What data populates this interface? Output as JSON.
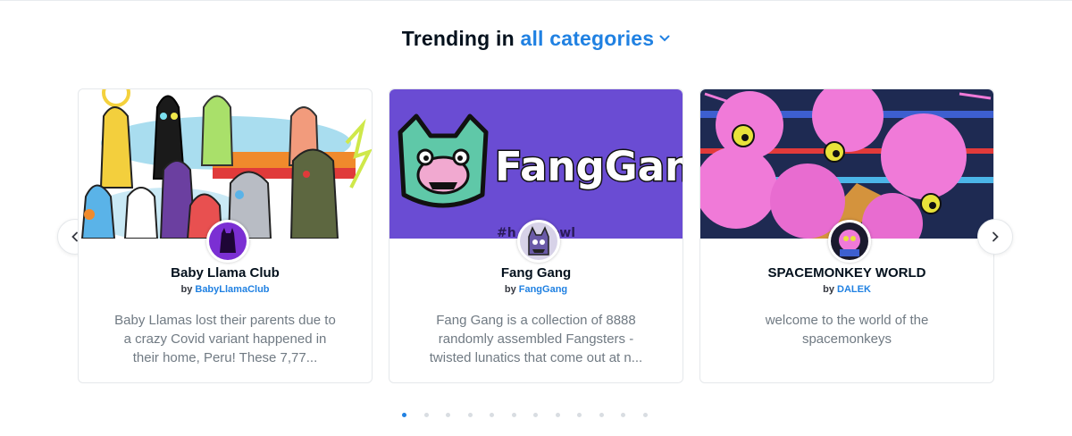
{
  "heading": {
    "prefix": "Trending in",
    "category": "all categories"
  },
  "cards": [
    {
      "title": "Baby Llama Club",
      "by_prefix": "by",
      "creator": "BabyLlamaClub",
      "description": "Baby Llamas lost their parents due to a crazy Covid variant happened in their home, Peru! These 7,77..."
    },
    {
      "title": "Fang Gang",
      "by_prefix": "by",
      "creator": "FangGang",
      "description": "Fang Gang is a collection of 8888 randomly assembled Fangsters - twisted lunatics that come out at n...",
      "banner_text": "FangGang",
      "banner_hashtag": "#h        owl"
    },
    {
      "title": "SPACEMONKEY WORLD",
      "by_prefix": "by",
      "creator": "DALEK",
      "description": "welcome to the world of the spacemonkeys"
    }
  ],
  "pagination": {
    "total": 12,
    "active_index": 0
  },
  "colors": {
    "accent": "#2081e2",
    "fang_bg": "#6a4cd3",
    "space_bg": "#1e2a52"
  },
  "icons": {
    "prev": "chevron-left-icon",
    "next": "chevron-right-icon",
    "dropdown": "chevron-down-icon"
  }
}
